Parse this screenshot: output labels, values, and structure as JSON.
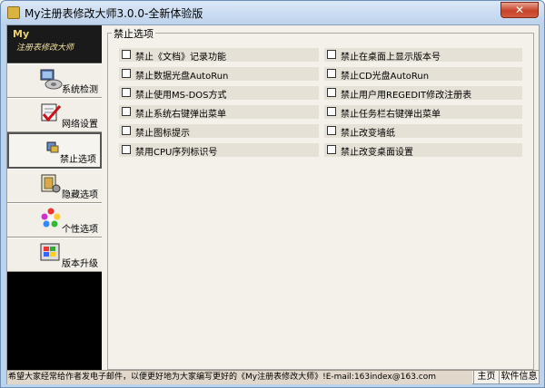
{
  "window": {
    "title": "My注册表修改大师3.0.0-全新体验版",
    "close_label": "✕"
  },
  "logo": {
    "my": "My",
    "name": "注册表修改大师"
  },
  "sidebar": {
    "items": [
      {
        "label": "系统检测",
        "icon": "system-check-icon",
        "active": false
      },
      {
        "label": "网络设置",
        "icon": "network-settings-icon",
        "active": false
      },
      {
        "label": "禁止选项",
        "icon": "disable-options-icon",
        "active": true
      },
      {
        "label": "隐藏选项",
        "icon": "hide-options-icon",
        "active": false
      },
      {
        "label": "个性选项",
        "icon": "personalize-icon",
        "active": false
      },
      {
        "label": "版本升级",
        "icon": "upgrade-icon",
        "active": false
      }
    ]
  },
  "group": {
    "title": "禁止选项",
    "left_options": [
      "禁止《文档》记录功能",
      "禁止数据光盘AutoRun",
      "禁止使用MS-DOS方式",
      "禁止系统右键弹出菜单",
      "禁止图标提示",
      "禁用CPU序列标识号"
    ],
    "right_options": [
      "禁止在桌面上显示版本号",
      "禁止CD光盘AutoRun",
      "禁止用户用REGEDIT修改注册表",
      "禁止任务栏右键弹出菜单",
      "禁止改变墙纸",
      "禁止改变桌面设置"
    ]
  },
  "statusbar": {
    "message": "希望大家经常给作者发电子邮件，以便更好地为大家编写更好的《My注册表修改大师》!E-mail:163index@163.com",
    "home_label": "主页",
    "info_label": "软件信息"
  }
}
